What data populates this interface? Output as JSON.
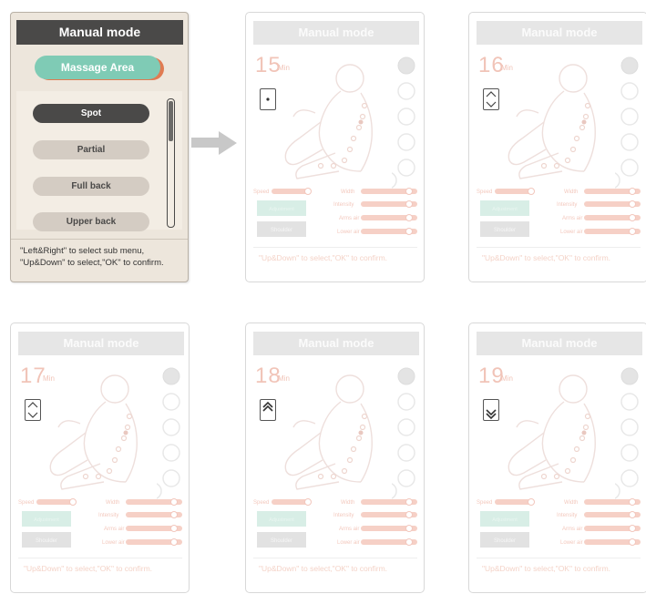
{
  "main_panel": {
    "title": "Manual mode",
    "massage_area_label": "Massage Area",
    "menu_items": [
      {
        "label": "Spot",
        "selected": true
      },
      {
        "label": "Partial",
        "selected": false
      },
      {
        "label": "Full back",
        "selected": false
      },
      {
        "label": "Upper back",
        "selected": false
      }
    ],
    "instruction_line1": "\"Left&Right\" to select sub menu,",
    "instruction_line2": "\"Up&Down\" to select,\"OK\" to confirm."
  },
  "faded_panels": [
    {
      "title": "Manual mode",
      "timer": "15",
      "unit": "Min",
      "indicator_icon": "spot-dot-icon"
    },
    {
      "title": "Manual mode",
      "timer": "16",
      "unit": "Min",
      "indicator_icon": "up-down-outline-icon"
    },
    {
      "title": "Manual mode",
      "timer": "17",
      "unit": "Min",
      "indicator_icon": "up-down-outline-icon"
    },
    {
      "title": "Manual mode",
      "timer": "18",
      "unit": "Min",
      "indicator_icon": "up-filled-icon"
    },
    {
      "title": "Manual mode",
      "timer": "19",
      "unit": "Min",
      "indicator_icon": "down-filled-icon"
    }
  ],
  "faded_controls": {
    "speed": "Speed",
    "width": "Width",
    "intensity": "Intensity",
    "arms_air": "Arms air",
    "lower_air": "Lower air",
    "button1": "Adjustment",
    "button2": "Shoulder"
  },
  "faded_instruction": "\"Up&Down\" to select,\"OK\" to confirm.",
  "colors": {
    "title_bar": "#4a4948",
    "panel_bg": "#ede6dc",
    "accent_teal": "#7fcbb5",
    "accent_orange": "#e07b52",
    "faded_accent": "#f1c4b8"
  }
}
